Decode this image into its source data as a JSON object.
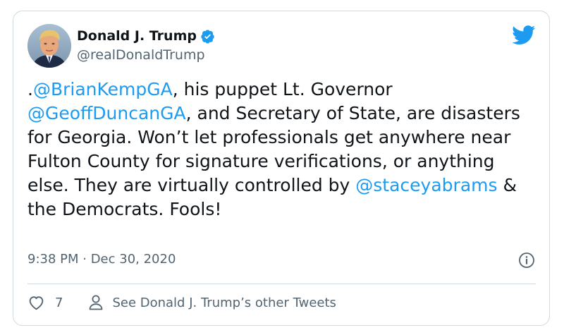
{
  "tweet": {
    "author_name": "Donald J. Trump",
    "author_handle": "@realDonaldTrump",
    "text_segments": [
      {
        "text": ".",
        "type": "text"
      },
      {
        "text": "@BrianKempGA",
        "type": "mention"
      },
      {
        "text": ", his puppet Lt. Governor ",
        "type": "text"
      },
      {
        "text": "@GeoffDuncanGA",
        "type": "mention"
      },
      {
        "text": ", and Secretary of State, are disasters for Georgia. Won’t let professionals get anywhere near Fulton County for signature verifications, or anything else. They are virtually controlled by ",
        "type": "text"
      },
      {
        "text": "@staceyabrams",
        "type": "mention"
      },
      {
        "text": " & the Democrats. Fools!",
        "type": "text"
      }
    ],
    "timestamp": "9:38 PM · Dec 30, 2020",
    "like_count": "7",
    "other_tweets_label": "See Donald J. Trump’s other Tweets"
  },
  "icons": {
    "verified": "verified-badge-icon",
    "brand": "twitter-bird-icon",
    "info": "info-icon",
    "like": "heart-icon",
    "profile": "person-icon"
  },
  "colors": {
    "link": "#1d9bf0",
    "text": "#0f1419",
    "secondary": "#536471",
    "border": "#cfd9de"
  }
}
